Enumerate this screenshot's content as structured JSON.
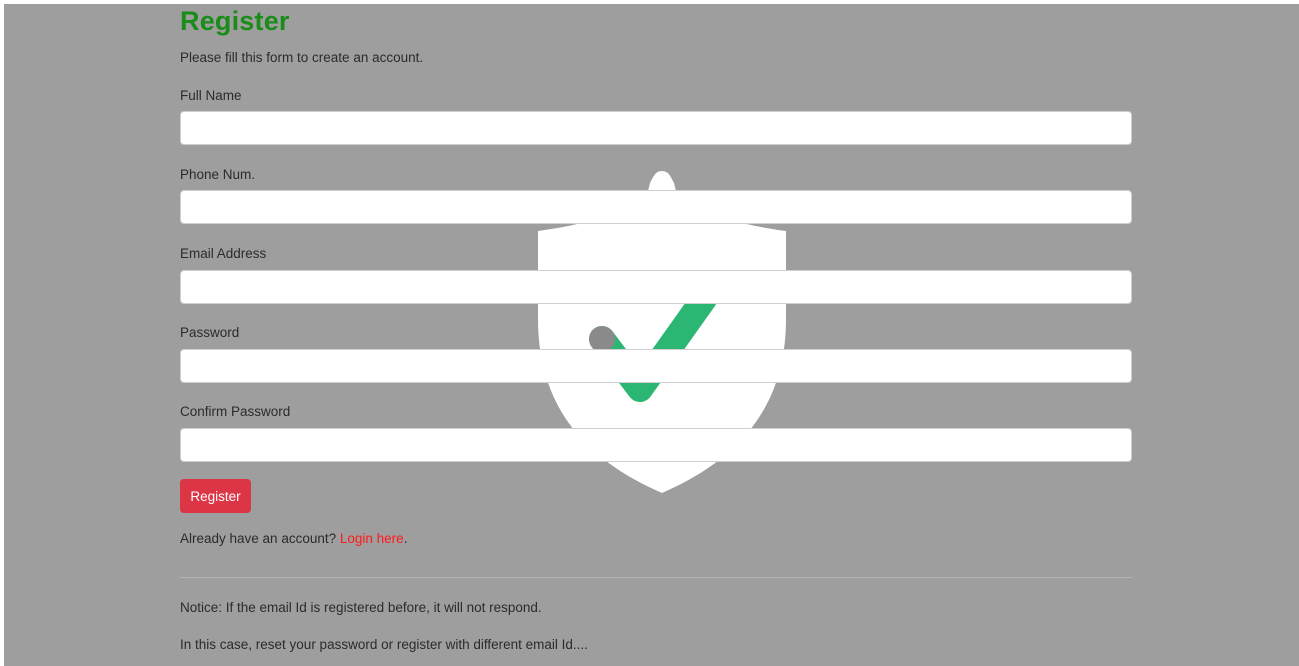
{
  "form": {
    "title": "Register",
    "subtitle": "Please fill this form to create an account.",
    "fields": [
      {
        "label": "Full Name",
        "value": "",
        "placeholder": ""
      },
      {
        "label": "Phone Num.",
        "value": "",
        "placeholder": ""
      },
      {
        "label": "Email Address",
        "value": "",
        "placeholder": ""
      },
      {
        "label": "Password",
        "value": "",
        "placeholder": ""
      },
      {
        "label": "Confirm Password",
        "value": "",
        "placeholder": ""
      }
    ],
    "submit_label": "Register"
  },
  "login": {
    "prompt": "Already have an account?",
    "link_label": "Login here",
    "suffix": "."
  },
  "notices": [
    "Notice: If the email Id is registered before, it will not respond.",
    "In this case, reset your password or register with different email Id...."
  ],
  "background_icon": "shield-check-icon",
  "colors": {
    "background": "#9e9e9e",
    "title": "#198c19",
    "button": "#dc3545",
    "link": "#ff1a1a",
    "check": "#2bb673"
  }
}
